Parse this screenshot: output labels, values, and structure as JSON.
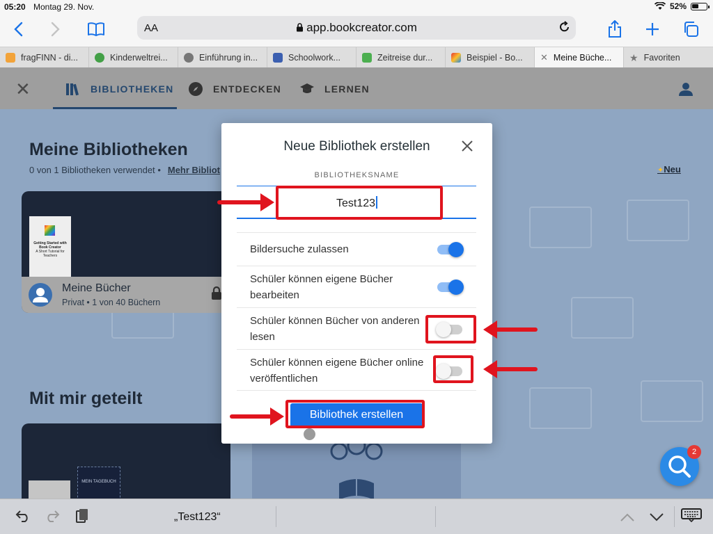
{
  "status": {
    "time": "05:20",
    "date": "Montag 29. Nov.",
    "battery": "52%"
  },
  "browser": {
    "aa_label": "AA",
    "url": "app.bookcreator.com",
    "tabs": [
      {
        "label": "fragFINN - di...",
        "color": "#f2a33a"
      },
      {
        "label": "Kinderweltrei...",
        "color": "#43a047"
      },
      {
        "label": "Einführung in...",
        "color": "#777777"
      },
      {
        "label": "Schoolwork...",
        "color": "#3b5fb0"
      },
      {
        "label": "Zeitreise dur...",
        "color": "#4caf50"
      },
      {
        "label": "Beispiel - Bo...",
        "color": "#d81b60"
      },
      {
        "label": "Meine Büche...",
        "color": "#888888"
      },
      {
        "label": "Favoriten",
        "color": "#888888"
      }
    ]
  },
  "app": {
    "nav": {
      "libraries": "BIBLIOTHEKEN",
      "discover": "ENTDECKEN",
      "learn": "LERNEN"
    },
    "title": "Meine Bibliotheken",
    "subtitle": "0 von 1 Bibliotheken verwendet",
    "more_link": "Mehr Bibliot",
    "new_link": "Neu",
    "card": {
      "name": "Meine Bücher",
      "meta": "Privat • 1 von 40 Büchern",
      "book_title": "Getting Started with Book Creator",
      "book_subtitle": "A Short Tutorial for Teachers"
    },
    "shared_title": "Mit mir geteilt",
    "diary_title": "MEIN TAGEBUCH",
    "fab_badge": "2"
  },
  "modal": {
    "title": "Neue Bibliothek erstellen",
    "field_label": "BIBLIOTHEKSNAME",
    "field_value": "Test123",
    "settings": [
      {
        "label": "Bildersuche zulassen",
        "on": true
      },
      {
        "label": "Schüler können eigene Bücher bearbeiten",
        "on": true
      },
      {
        "label": "Schüler können Bücher von anderen lesen",
        "on": false
      },
      {
        "label": "Schüler können eigene Bücher online veröffentlichen",
        "on": false
      }
    ],
    "create_button": "Bibliothek erstellen"
  },
  "keyboard_bar": {
    "suggestion": "„Test123“"
  },
  "colors": {
    "accent": "#1a73e8",
    "annotation_red": "#e0141e",
    "appbar_dim": "#9e9e9e"
  }
}
